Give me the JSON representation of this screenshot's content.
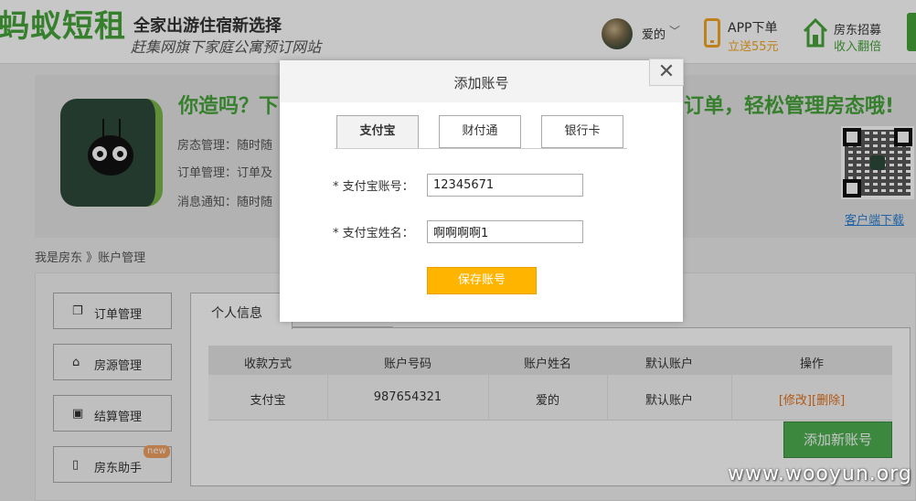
{
  "header": {
    "logo": "蚂蚁短租",
    "slogan": "全家出游住宿新选择",
    "subslogan": "赶集网旗下家庭公寓预订网站",
    "username": "爱的",
    "app_line1": "APP下单",
    "app_line2": "立送55元",
    "host_line1": "房东招募",
    "host_line2": "收入翻倍"
  },
  "banner": {
    "headline": "你造吗？下",
    "headline_tail": "订单，轻松管理房态哦!",
    "lines": [
      "房态管理：随时随",
      "订单管理：订单及",
      "消息通知：随时随"
    ],
    "download_link": "客户端下载"
  },
  "breadcrumb": "我是房东 》账户管理",
  "sidebar": {
    "items": [
      {
        "label": "订单管理",
        "icon": "copy-icon"
      },
      {
        "label": "房源管理",
        "icon": "home-icon"
      },
      {
        "label": "结算管理",
        "icon": "bag-icon"
      },
      {
        "label": "房东助手",
        "icon": "phone-icon",
        "badge": "new"
      }
    ]
  },
  "account_tabs": {
    "personal": "个人信息"
  },
  "table": {
    "headers": [
      "收款方式",
      "账户号码",
      "账户姓名",
      "默认账户",
      "操作"
    ],
    "rows": [
      {
        "method": "支付宝",
        "number": "987654321",
        "name": "爱的",
        "default": "默认账户",
        "edit": "[修改]",
        "delete": "[删除]"
      }
    ]
  },
  "add_account_button": "添加新账号",
  "modal": {
    "title": "添加账号",
    "tabs": [
      "支付宝",
      "财付通",
      "银行卡"
    ],
    "active_tab": 0,
    "account_label": "* 支付宝账号：",
    "account_value": "12345671",
    "name_label": "* 支付宝姓名：",
    "name_value": "啊啊啊啊1",
    "save_label": "保存账号",
    "close_glyph": "✕"
  },
  "watermark": "www.wooyun.org"
}
